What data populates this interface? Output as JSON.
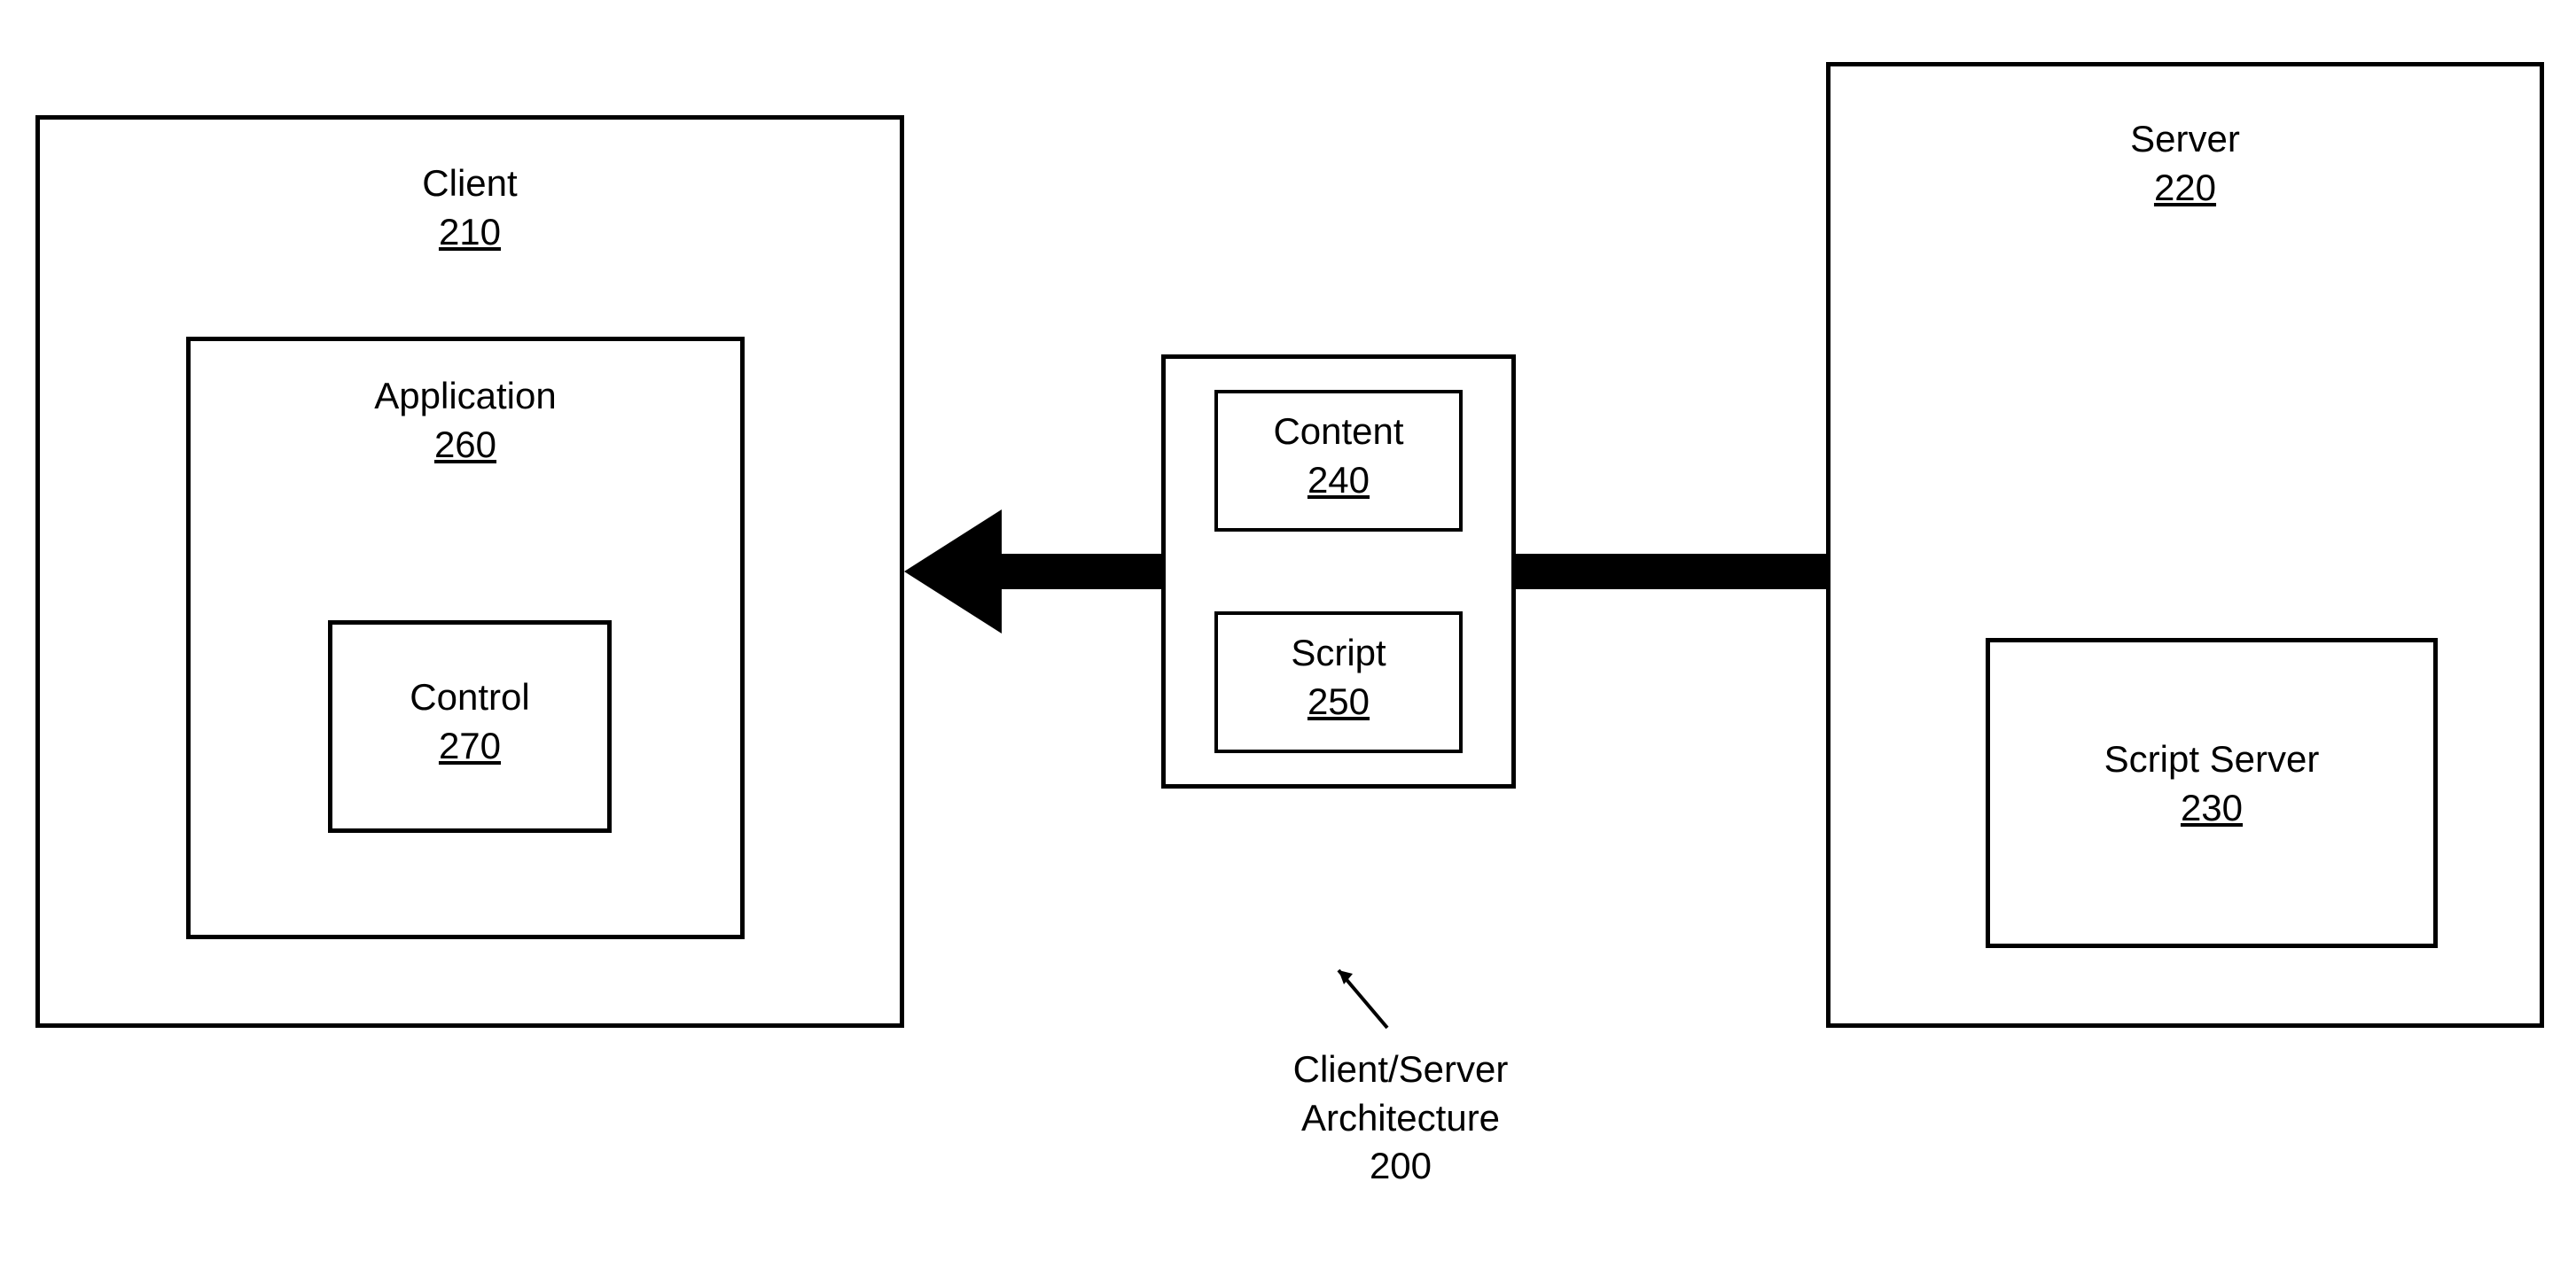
{
  "client": {
    "title": "Client",
    "ref": "210",
    "application": {
      "title": "Application",
      "ref": "260",
      "control": {
        "title": "Control",
        "ref": "270"
      }
    }
  },
  "server": {
    "title": "Server",
    "ref": "220",
    "script_server": {
      "title": "Script Server",
      "ref": "230"
    }
  },
  "payload": {
    "content": {
      "title": "Content",
      "ref": "240"
    },
    "script": {
      "title": "Script",
      "ref": "250"
    }
  },
  "caption": {
    "line1": "Client/Server",
    "line2": "Architecture",
    "ref": "200"
  }
}
